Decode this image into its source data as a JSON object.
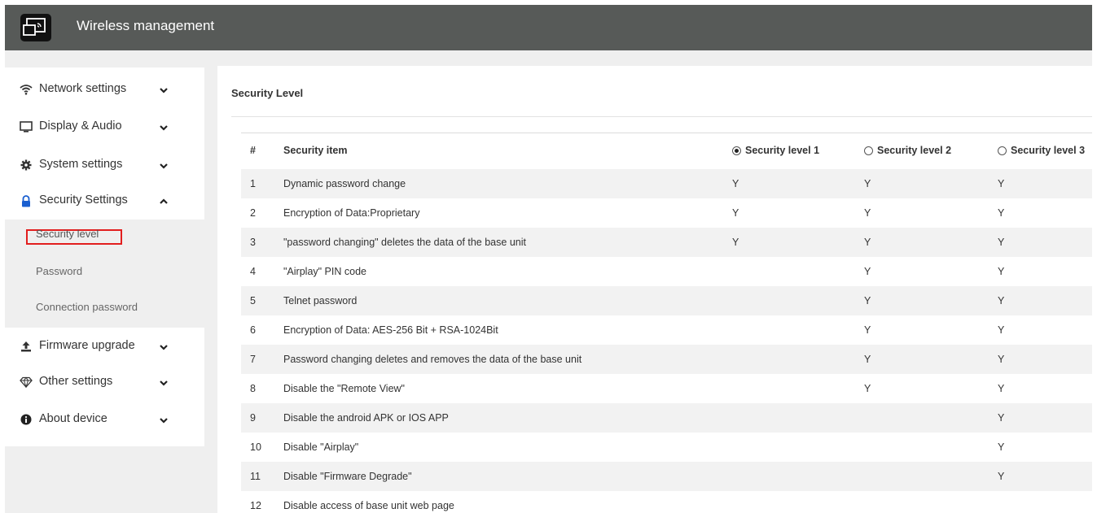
{
  "app": {
    "title": "Wireless management",
    "logo_icon": "screen-cast-icon"
  },
  "sidebar": {
    "items": [
      {
        "label": "Network settings",
        "icon": "wifi-icon",
        "expanded": false
      },
      {
        "label": "Display & Audio",
        "icon": "monitor-icon",
        "expanded": false
      },
      {
        "label": "System settings",
        "icon": "gear-icon",
        "expanded": false
      },
      {
        "label": "Security Settings",
        "icon": "lock-icon",
        "expanded": true
      },
      {
        "label": "Firmware upgrade",
        "icon": "upload-icon",
        "expanded": false
      },
      {
        "label": "Other settings",
        "icon": "diamond-icon",
        "expanded": false
      },
      {
        "label": "About device",
        "icon": "info-icon",
        "expanded": false
      }
    ],
    "sub_items": [
      {
        "label": "Security level",
        "active": true
      },
      {
        "label": "Password",
        "active": false
      },
      {
        "label": "Connection password",
        "active": false
      }
    ]
  },
  "main": {
    "title": "Security Level",
    "table": {
      "headers": {
        "num": "#",
        "item": "Security item",
        "level1": "Security level 1",
        "level2": "Security level 2",
        "level3": "Security level 3"
      },
      "selected_level": "level1",
      "rows": [
        {
          "num": "1",
          "item": "Dynamic password change",
          "l1": "Y",
          "l2": "Y",
          "l3": "Y"
        },
        {
          "num": "2",
          "item": "Encryption of Data:Proprietary",
          "l1": "Y",
          "l2": "Y",
          "l3": "Y"
        },
        {
          "num": "3",
          "item": "\"password changing\" deletes the data of the base unit",
          "l1": "Y",
          "l2": "Y",
          "l3": "Y"
        },
        {
          "num": "4",
          "item": "\"Airplay\" PIN code",
          "l1": "",
          "l2": "Y",
          "l3": "Y"
        },
        {
          "num": "5",
          "item": "Telnet password",
          "l1": "",
          "l2": "Y",
          "l3": "Y"
        },
        {
          "num": "6",
          "item": "Encryption of Data: AES-256 Bit + RSA-1024Bit",
          "l1": "",
          "l2": "Y",
          "l3": "Y"
        },
        {
          "num": "7",
          "item": "Password changing deletes and removes the data of the base unit",
          "l1": "",
          "l2": "Y",
          "l3": "Y"
        },
        {
          "num": "8",
          "item": "Disable the \"Remote View\"",
          "l1": "",
          "l2": "Y",
          "l3": "Y"
        },
        {
          "num": "9",
          "item": "Disable the android APK or IOS APP",
          "l1": "",
          "l2": "",
          "l3": "Y"
        },
        {
          "num": "10",
          "item": "Disable \"Airplay\"",
          "l1": "",
          "l2": "",
          "l3": "Y"
        },
        {
          "num": "11",
          "item": "Disable \"Firmware Degrade\"",
          "l1": "",
          "l2": "",
          "l3": "Y"
        },
        {
          "num": "12",
          "item": "Disable access of base unit web page",
          "l1": "",
          "l2": "",
          "l3": ""
        }
      ]
    }
  },
  "colors": {
    "topbar": "#575a58",
    "highlight": "#e21e1e",
    "row_alt": "#f2f2f2",
    "page_bg": "#efefef"
  }
}
